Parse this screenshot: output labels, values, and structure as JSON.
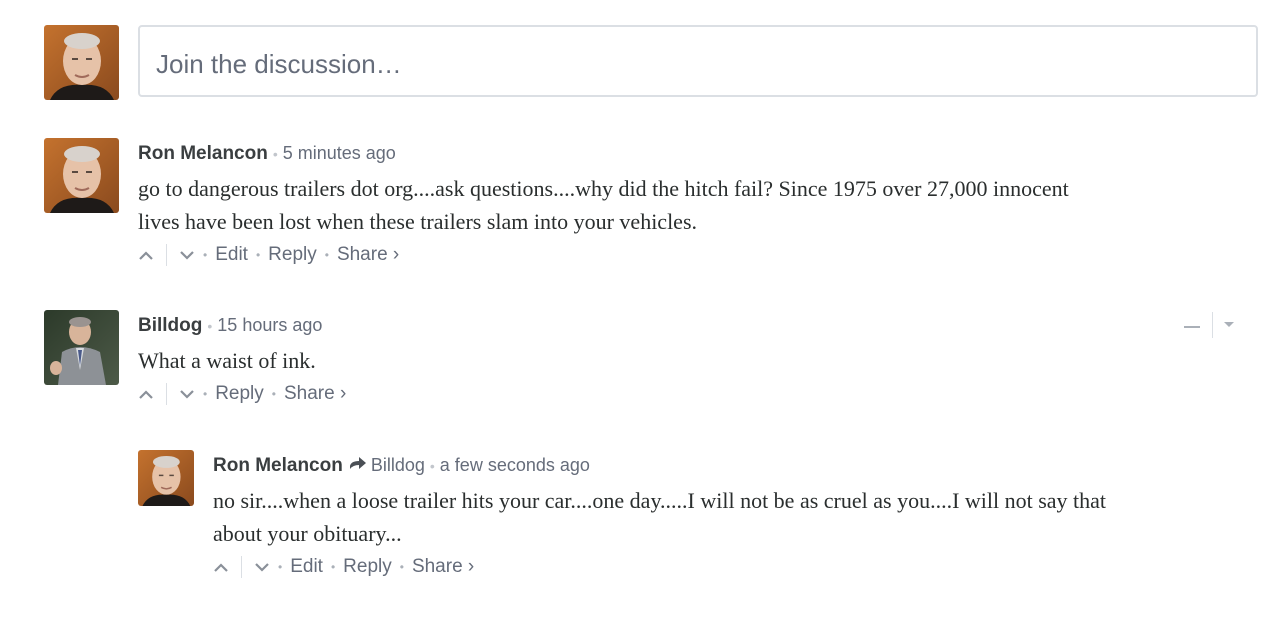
{
  "compose": {
    "placeholder": "Join the discussion…"
  },
  "comments": [
    {
      "author": "Ron Melancon",
      "time": "5 minutes ago",
      "body_lines": [
        "go to dangerous trailers dot org....ask questions....why did the hitch fail? Since 1975 over 27,000 innocent",
        "lives have been lost when these trailers slam into your vehicles."
      ],
      "actions": [
        "Edit",
        "Reply",
        "Share ›"
      ]
    },
    {
      "author": "Billdog",
      "time": "15 hours ago",
      "body_lines": [
        "What a waist of ink."
      ],
      "actions": [
        "Reply",
        "Share ›"
      ]
    },
    {
      "author": "Ron Melancon",
      "reply_to": "Billdog",
      "time": "a few seconds ago",
      "body_lines": [
        "no sir....when a loose trailer hits your car....one day.....I will not be as cruel as you....I will not say that",
        "about your obituary..."
      ],
      "actions": [
        "Edit",
        "Reply",
        "Share ›"
      ]
    }
  ],
  "icons": {
    "upvote": "chevron-up-icon",
    "downvote": "chevron-down-icon",
    "reply_arrow": "reply-arrow-icon",
    "collapse": "minus-icon",
    "menu": "caret-down-icon"
  },
  "colors": {
    "meta_text": "#656c7a",
    "border": "#dbdfe4",
    "author_text": "#3a3e40"
  }
}
